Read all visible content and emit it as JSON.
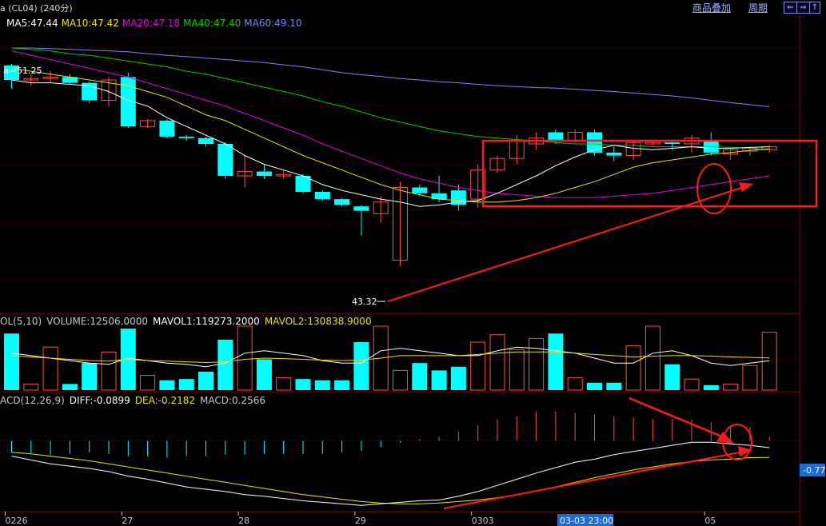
{
  "header": {
    "title": "a (CL04) (240分)",
    "menu_overlay": "商品叠加",
    "menu_period": "周期",
    "nav_buttons": [
      "⇐",
      "⇒",
      "↑",
      "↓"
    ]
  },
  "colors": {
    "up": "#ff4d4d",
    "down": "#00ffff",
    "ma5": "#ffffff",
    "ma10": "#e6e600",
    "ma20": "#e000e0",
    "ma40": "#00cc00",
    "ma60": "#8080ff",
    "annotation": "#ff1a1a",
    "grid": "#6b0000",
    "axis_text": "#c8c8c8"
  },
  "price_panel": {
    "legend": [
      {
        "label": "MA5:47.44",
        "color": "#ffffff"
      },
      {
        "label": "MA10:47.42",
        "color": "#e6e600"
      },
      {
        "label": "MA20:47.18",
        "color": "#e000e0"
      },
      {
        "label": "MA40:47.40",
        "color": "#00cc00"
      },
      {
        "label": "MA60:49.10",
        "color": "#8080ff"
      }
    ],
    "high_label": "51.25",
    "low_label": "43.32"
  },
  "volume_panel": {
    "legend": [
      {
        "label": "OL(5,10)",
        "color": "#c8c8c8"
      },
      {
        "label": "VOLUME:12506.0000",
        "color": "#c8c8c8"
      },
      {
        "label": "MAVOL1:119273.2000",
        "color": "#ffffff"
      },
      {
        "label": "MAVOL2:130838.9000",
        "color": "#e6e600"
      }
    ]
  },
  "macd_panel": {
    "legend": [
      {
        "label": "ACD(12,26,9)",
        "color": "#c8c8c8"
      },
      {
        "label": "DIFF:-0.0899",
        "color": "#ffffff"
      },
      {
        "label": "DEA:-0.2182",
        "color": "#e6e600"
      },
      {
        "label": "MACD:0.2566",
        "color": "#c8c8c8"
      }
    ],
    "right_value": "-0.77"
  },
  "x_axis": {
    "labels": [
      {
        "text": "0226",
        "i": 0
      },
      {
        "text": "27",
        "i": 6
      },
      {
        "text": "28",
        "i": 12
      },
      {
        "text": "29",
        "i": 18
      },
      {
        "text": "0303",
        "i": 24
      },
      {
        "text": "05",
        "i": 36
      }
    ],
    "cursor_label": "03-03 23:00",
    "cursor_index": 29
  },
  "chart_data": {
    "type": "candlestick",
    "ylim": [
      43.0,
      51.8
    ],
    "candles": [
      {
        "o": 51.2,
        "h": 51.25,
        "l": 50.4,
        "c": 50.7
      },
      {
        "o": 50.7,
        "h": 50.9,
        "l": 50.5,
        "c": 50.75
      },
      {
        "o": 50.75,
        "h": 51.0,
        "l": 50.6,
        "c": 50.8
      },
      {
        "o": 50.8,
        "h": 50.9,
        "l": 50.55,
        "c": 50.6
      },
      {
        "o": 50.6,
        "h": 50.65,
        "l": 49.9,
        "c": 50.0
      },
      {
        "o": 50.0,
        "h": 50.8,
        "l": 49.8,
        "c": 50.7
      },
      {
        "o": 50.8,
        "h": 50.95,
        "l": 49.05,
        "c": 49.1
      },
      {
        "o": 49.1,
        "h": 49.35,
        "l": 49.05,
        "c": 49.3
      },
      {
        "o": 49.3,
        "h": 49.35,
        "l": 48.7,
        "c": 48.75
      },
      {
        "o": 48.75,
        "h": 48.8,
        "l": 48.6,
        "c": 48.7
      },
      {
        "o": 48.7,
        "h": 48.75,
        "l": 48.4,
        "c": 48.5
      },
      {
        "o": 48.5,
        "h": 48.55,
        "l": 47.3,
        "c": 47.4
      },
      {
        "o": 47.4,
        "h": 48.1,
        "l": 47.0,
        "c": 47.55
      },
      {
        "o": 47.55,
        "h": 47.8,
        "l": 47.3,
        "c": 47.4
      },
      {
        "o": 47.4,
        "h": 47.6,
        "l": 47.3,
        "c": 47.45
      },
      {
        "o": 47.4,
        "h": 47.45,
        "l": 46.8,
        "c": 46.85
      },
      {
        "o": 46.85,
        "h": 46.9,
        "l": 46.55,
        "c": 46.6
      },
      {
        "o": 46.6,
        "h": 46.65,
        "l": 46.35,
        "c": 46.4
      },
      {
        "o": 46.35,
        "h": 46.4,
        "l": 45.35,
        "c": 46.2
      },
      {
        "o": 46.1,
        "h": 46.7,
        "l": 45.8,
        "c": 46.5
      },
      {
        "o": 44.5,
        "h": 47.2,
        "l": 44.3,
        "c": 47.0
      },
      {
        "o": 47.0,
        "h": 47.1,
        "l": 46.7,
        "c": 46.8
      },
      {
        "o": 46.8,
        "h": 47.4,
        "l": 46.5,
        "c": 46.6
      },
      {
        "o": 46.9,
        "h": 47.1,
        "l": 46.2,
        "c": 46.4
      },
      {
        "o": 46.6,
        "h": 47.8,
        "l": 46.3,
        "c": 47.6
      },
      {
        "o": 47.6,
        "h": 48.1,
        "l": 47.5,
        "c": 48.0
      },
      {
        "o": 48.0,
        "h": 48.8,
        "l": 47.8,
        "c": 48.6
      },
      {
        "o": 48.5,
        "h": 48.9,
        "l": 48.3,
        "c": 48.7
      },
      {
        "o": 48.9,
        "h": 49.0,
        "l": 48.5,
        "c": 48.6
      },
      {
        "o": 48.6,
        "h": 49.0,
        "l": 48.55,
        "c": 48.9
      },
      {
        "o": 48.9,
        "h": 49.0,
        "l": 48.1,
        "c": 48.2
      },
      {
        "o": 48.2,
        "h": 48.4,
        "l": 47.9,
        "c": 48.1
      },
      {
        "o": 48.1,
        "h": 48.6,
        "l": 47.95,
        "c": 48.55
      },
      {
        "o": 48.5,
        "h": 48.6,
        "l": 48.45,
        "c": 48.55
      },
      {
        "o": 48.55,
        "h": 48.65,
        "l": 48.3,
        "c": 48.5
      },
      {
        "o": 48.5,
        "h": 48.8,
        "l": 48.2,
        "c": 48.7
      },
      {
        "o": 48.6,
        "h": 48.9,
        "l": 48.1,
        "c": 48.2
      },
      {
        "o": 48.15,
        "h": 48.35,
        "l": 47.95,
        "c": 48.3
      },
      {
        "o": 48.25,
        "h": 48.4,
        "l": 48.1,
        "c": 48.35
      },
      {
        "o": 48.3,
        "h": 48.45,
        "l": 48.2,
        "c": 48.4
      }
    ],
    "ma5": [
      50.7,
      50.6,
      50.6,
      50.55,
      50.5,
      50.3,
      50.0,
      49.8,
      49.4,
      49.1,
      48.8,
      48.5,
      48.1,
      47.8,
      47.6,
      47.4,
      47.1,
      46.9,
      46.75,
      46.6,
      46.5,
      46.35,
      46.4,
      46.5,
      46.55,
      46.8,
      47.1,
      47.4,
      47.75,
      48.05,
      48.3,
      48.45,
      48.35,
      48.3,
      48.35,
      48.4,
      48.35,
      48.35,
      48.38,
      48.4
    ],
    "ma10": [
      51.1,
      51.0,
      50.9,
      50.8,
      50.7,
      50.6,
      50.5,
      50.3,
      50.1,
      49.8,
      49.5,
      49.3,
      49.0,
      48.7,
      48.4,
      48.1,
      47.85,
      47.6,
      47.35,
      47.1,
      46.9,
      46.75,
      46.6,
      46.55,
      46.5,
      46.5,
      46.55,
      46.65,
      46.8,
      47.0,
      47.2,
      47.45,
      47.7,
      47.85,
      47.95,
      48.05,
      48.15,
      48.2,
      48.28,
      48.33
    ],
    "ma20": [
      51.7,
      51.55,
      51.4,
      51.25,
      51.1,
      50.95,
      50.8,
      50.6,
      50.4,
      50.2,
      50.0,
      49.8,
      49.55,
      49.3,
      49.05,
      48.8,
      48.5,
      48.25,
      48.0,
      47.75,
      47.5,
      47.3,
      47.15,
      47.0,
      46.9,
      46.8,
      46.75,
      46.7,
      46.65,
      46.65,
      46.65,
      46.7,
      46.75,
      46.8,
      46.9,
      47.0,
      47.1,
      47.2,
      47.3,
      47.4
    ],
    "ma40": [
      51.8,
      51.75,
      51.7,
      51.6,
      51.55,
      51.45,
      51.35,
      51.25,
      51.15,
      51.0,
      50.9,
      50.75,
      50.6,
      50.45,
      50.3,
      50.15,
      49.95,
      49.8,
      49.6,
      49.4,
      49.25,
      49.1,
      48.95,
      48.85,
      48.75,
      48.7,
      48.65,
      48.6,
      48.55,
      48.5,
      48.5,
      48.45,
      48.45,
      48.4,
      48.4,
      48.4,
      48.4,
      48.38,
      48.35,
      48.3
    ],
    "ma60": [
      51.8,
      51.8,
      51.78,
      51.75,
      51.72,
      51.7,
      51.67,
      51.6,
      51.55,
      51.5,
      51.45,
      51.4,
      51.35,
      51.3,
      51.22,
      51.15,
      51.05,
      50.95,
      50.88,
      50.82,
      50.75,
      50.7,
      50.64,
      50.6,
      50.55,
      50.5,
      50.47,
      50.44,
      50.42,
      50.38,
      50.34,
      50.3,
      50.25,
      50.2,
      50.15,
      50.08,
      50.0,
      49.92,
      49.85,
      49.78
    ],
    "volume": {
      "ylim": [
        0,
        260000
      ],
      "values": [
        230000,
        25000,
        175000,
        25000,
        110000,
        155000,
        250000,
        60000,
        40000,
        45000,
        75000,
        205000,
        310000,
        125000,
        50000,
        45000,
        40000,
        40000,
        195000,
        325000,
        80000,
        110000,
        80000,
        95000,
        195000,
        225000,
        165000,
        210000,
        230000,
        50000,
        30000,
        30000,
        180000,
        335000,
        105000,
        45000,
        20000,
        25000,
        100000,
        235000
      ],
      "mavol1": [
        150000,
        140000,
        130000,
        120000,
        110000,
        105000,
        130000,
        120000,
        110000,
        105000,
        95000,
        110000,
        150000,
        160000,
        150000,
        140000,
        120000,
        110000,
        110000,
        160000,
        170000,
        160000,
        150000,
        140000,
        140000,
        160000,
        175000,
        170000,
        160000,
        150000,
        130000,
        110000,
        110000,
        150000,
        160000,
        140000,
        110000,
        100000,
        110000,
        119273
      ],
      "mavol2": [
        140000,
        135000,
        130000,
        125000,
        120000,
        118000,
        125000,
        120000,
        118000,
        115000,
        112000,
        115000,
        125000,
        130000,
        128000,
        125000,
        122000,
        120000,
        122000,
        130000,
        140000,
        140000,
        140000,
        140000,
        145000,
        150000,
        155000,
        155000,
        155000,
        150000,
        145000,
        140000,
        135000,
        138000,
        140000,
        140000,
        138000,
        135000,
        133000,
        130838
      ]
    },
    "macd": {
      "ylim": [
        -0.9,
        0.45
      ],
      "hist": [
        -0.15,
        -0.16,
        -0.18,
        -0.17,
        -0.15,
        -0.17,
        -0.2,
        -0.2,
        -0.22,
        -0.2,
        -0.2,
        -0.18,
        -0.18,
        -0.17,
        -0.17,
        -0.17,
        -0.17,
        -0.15,
        -0.13,
        -0.08,
        -0.02,
        0.02,
        0.05,
        0.12,
        0.2,
        0.28,
        0.32,
        0.38,
        0.38,
        0.36,
        0.34,
        0.32,
        0.3,
        0.28,
        0.28,
        0.27,
        0.24,
        0.2,
        0.18,
        0.05
      ],
      "diff": [
        -0.2,
        -0.25,
        -0.3,
        -0.33,
        -0.36,
        -0.4,
        -0.46,
        -0.5,
        -0.55,
        -0.6,
        -0.63,
        -0.66,
        -0.7,
        -0.72,
        -0.75,
        -0.78,
        -0.8,
        -0.82,
        -0.84,
        -0.82,
        -0.8,
        -0.78,
        -0.77,
        -0.72,
        -0.66,
        -0.58,
        -0.5,
        -0.42,
        -0.35,
        -0.28,
        -0.24,
        -0.18,
        -0.14,
        -0.1,
        -0.06,
        -0.02,
        -0.02,
        -0.04,
        -0.06,
        -0.0899
      ],
      "dea": [
        -0.15,
        -0.17,
        -0.2,
        -0.23,
        -0.26,
        -0.3,
        -0.34,
        -0.38,
        -0.42,
        -0.46,
        -0.5,
        -0.54,
        -0.58,
        -0.62,
        -0.66,
        -0.7,
        -0.73,
        -0.76,
        -0.79,
        -0.81,
        -0.82,
        -0.82,
        -0.81,
        -0.79,
        -0.77,
        -0.74,
        -0.7,
        -0.65,
        -0.6,
        -0.54,
        -0.48,
        -0.43,
        -0.38,
        -0.34,
        -0.3,
        -0.27,
        -0.25,
        -0.24,
        -0.22,
        -0.2182
      ]
    }
  }
}
